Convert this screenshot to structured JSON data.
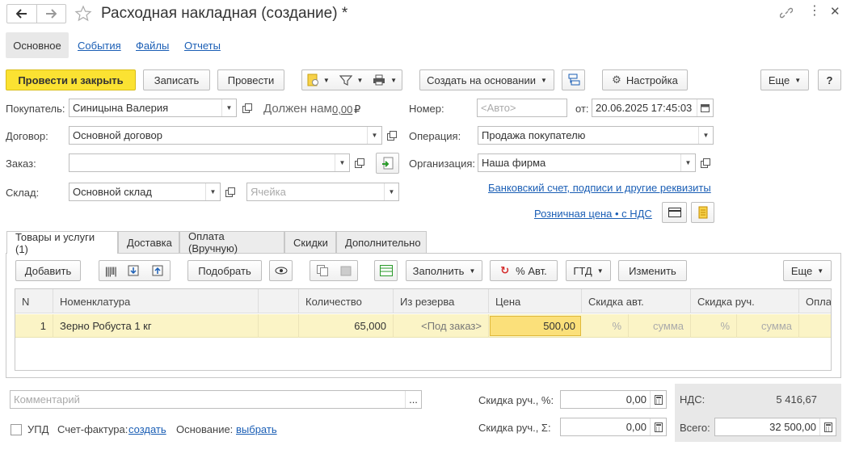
{
  "window": {
    "title": "Расходная накладная (создание) *"
  },
  "section_tabs": [
    "Основное",
    "События",
    "Файлы",
    "Отчеты"
  ],
  "toolbar": {
    "post_close": "Провести и закрыть",
    "save": "Записать",
    "post": "Провести",
    "create_based": "Создать на основании",
    "settings": "Настройка",
    "more": "Еще",
    "help": "?"
  },
  "form": {
    "buyer_label": "Покупатель:",
    "buyer_value": "Синицына Валерия",
    "owes_label": "Должен нам",
    "owes_value": "0,00",
    "currency": "₽",
    "number_label": "Номер:",
    "number_placeholder": "<Авто>",
    "date_label": "от:",
    "date_value": "20.06.2025 17:45:03",
    "contract_label": "Договор:",
    "contract_value": "Основной договор",
    "operation_label": "Операция:",
    "operation_value": "Продажа покупателю",
    "order_label": "Заказ:",
    "order_value": "",
    "org_label": "Организация:",
    "org_value": "Наша фирма",
    "warehouse_label": "Склад:",
    "warehouse_value": "Основной склад",
    "cell_placeholder": "Ячейка",
    "bank_link": "Банковский счет, подписи и другие реквизиты",
    "price_link": "Розничная цена • с НДС"
  },
  "doc_tabs": [
    "Товары и услуги (1)",
    "Доставка",
    "Оплата (Вручную)",
    "Скидки",
    "Дополнительно"
  ],
  "table_toolbar": {
    "add": "Добавить",
    "pick": "Подобрать",
    "fill": "Заполнить",
    "auto_percent": "% Авт.",
    "gtd": "ГТД",
    "change": "Изменить",
    "more": "Еще"
  },
  "table": {
    "columns": [
      "N",
      "Номенклатура",
      "",
      "Количество",
      "Из резерва",
      "Цена",
      "Скидка авт.",
      "Скидка руч.",
      "Опла"
    ],
    "rows": [
      {
        "n": "1",
        "item": "Зерно Робуста 1 кг",
        "qty": "65,000",
        "reserve": "<Под заказ>",
        "price": "500,00",
        "disc_auto_pct": "%",
        "disc_auto_sum": "сумма",
        "disc_man_pct": "%",
        "disc_man_sum": "сумма"
      }
    ]
  },
  "footer": {
    "comment_placeholder": "Комментарий",
    "comment_btn": "...",
    "disc_pct_label": "Скидка руч., %:",
    "disc_pct_value": "0,00",
    "disc_sum_label": "Скидка руч., Σ:",
    "disc_sum_value": "0,00",
    "vat_label": "НДС:",
    "vat_value": "5 416,67",
    "total_label": "Всего:",
    "total_value": "32 500,00",
    "upd_label": "УПД",
    "invoice_label": "Счет-фактура:",
    "invoice_link": "создать",
    "basis_label": "Основание:",
    "basis_link": "выбрать"
  }
}
